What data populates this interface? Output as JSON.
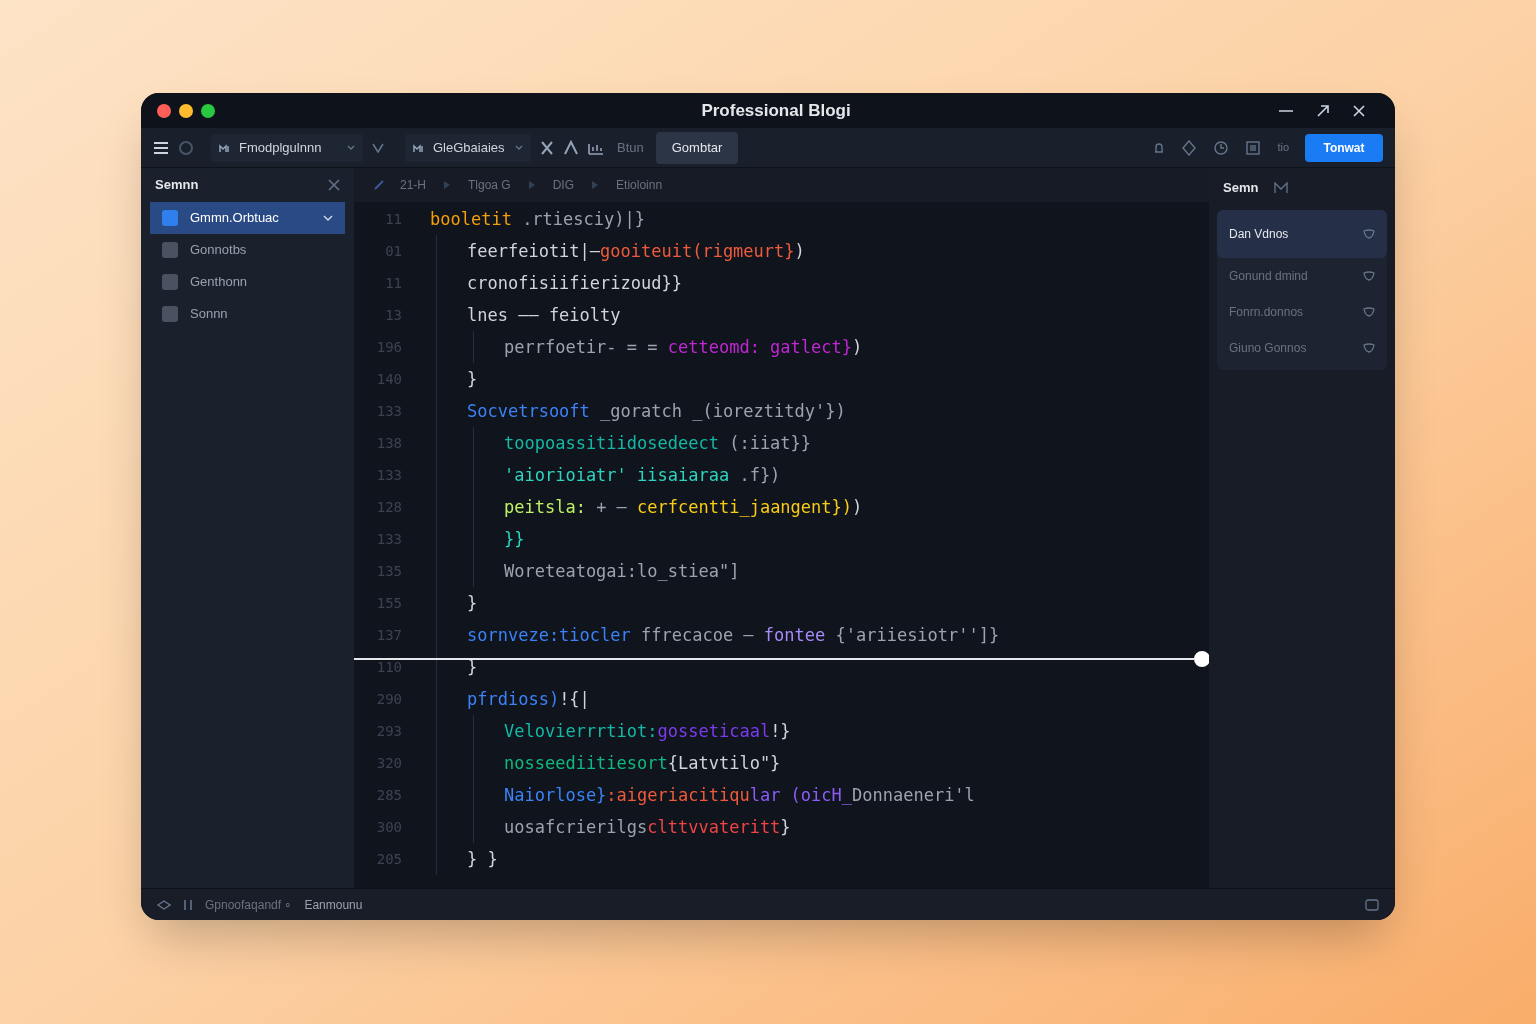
{
  "window": {
    "title": "Professional Blogi"
  },
  "toolbar": {
    "dropdowns": [
      {
        "label": "Fmodplgulnnn"
      },
      {
        "label": "GleGbaiaies"
      }
    ],
    "text_item": "Btun",
    "tab": {
      "label": "Gombtar",
      "selected": true
    },
    "right_text": "tio",
    "primary_button": "Tonwat"
  },
  "sidebar": {
    "title": "Semnn",
    "items": [
      {
        "label": "Gmmn.Orbtuac",
        "selected": true
      },
      {
        "label": "Gonnotbs",
        "selected": false
      },
      {
        "label": "Genthonn",
        "selected": false
      },
      {
        "label": "Sonnn",
        "selected": false
      }
    ]
  },
  "breadcrumbs": [
    "21-H",
    "Tlgoa G",
    "DIG",
    "Etioloinn"
  ],
  "code": {
    "lines": [
      {
        "number": "11",
        "segments": [
          {
            "text": "booletit",
            "color": "#f59e0b"
          },
          {
            "text": " .rtiesciy)|}",
            "color": "#9ca3af"
          }
        ],
        "children": [
          {
            "number": "01",
            "segments": [
              {
                "text": "feerfeiotit|—",
                "color": "#d1d5db"
              },
              {
                "text": "gooiteuit(rigmeurt}",
                "color": "#ef5a3c"
              },
              {
                "text": ")",
                "color": "#d1d5db"
              }
            ]
          },
          {
            "number": "11",
            "segments": [
              {
                "text": "cronofisiifierizoud}}",
                "color": "#d1d5db"
              }
            ]
          },
          {
            "number": "13",
            "segments": [
              {
                "text": "lnes —— feiolty",
                "color": "#d1d5db"
              }
            ],
            "children": [
              {
                "number": "196",
                "segments": [
                  {
                    "text": "perrfoetir- = = ",
                    "color": "#9ca3af"
                  },
                  {
                    "text": "cetteomd: gatlect}",
                    "color": "#c026d3"
                  },
                  {
                    "text": ")",
                    "color": "#d1d5db"
                  }
                ]
              }
            ]
          },
          {
            "number": "140",
            "segments": [
              {
                "text": "}",
                "color": "#d1d5db"
              }
            ]
          },
          {
            "number": "133",
            "segments": [
              {
                "text": "Socvetrsooft ",
                "color": "#3b82f6"
              },
              {
                "text": "_goratch _(ioreztitdy'})",
                "color": "#9ca3af"
              }
            ],
            "children": [
              {
                "number": "138",
                "segments": [
                  {
                    "text": "toopoassitiidosedeect",
                    "color": "#14b8a6"
                  },
                  {
                    "text": " (:iiat}}",
                    "color": "#9ca3af"
                  }
                ]
              },
              {
                "number": "133",
                "segments": [
                  {
                    "text": "'aiorioiatr' iisaiaraa",
                    "color": "#2dd4bf"
                  },
                  {
                    "text": " .f})",
                    "color": "#9ca3af"
                  }
                ]
              },
              {
                "number": "128",
                "segments": [
                  {
                    "text": "peitsla: ",
                    "color": "#bef264"
                  },
                  {
                    "text": "+ — ",
                    "color": "#9ca3af"
                  },
                  {
                    "text": "cerfcentti_jaangent})",
                    "color": "#facc15"
                  },
                  {
                    "text": ")",
                    "color": "#d1d5db"
                  }
                ]
              },
              {
                "number": "133",
                "segments": [
                  {
                    "text": "}}",
                    "color": "#2dd4bf"
                  }
                ]
              },
              {
                "number": "135",
                "segments": [
                  {
                    "text": "Woreteatogai:lo_stiea\"]",
                    "color": "#9ca3af"
                  }
                ]
              }
            ]
          },
          {
            "number": "155",
            "segments": [
              {
                "text": "}",
                "color": "#d1d5db"
              }
            ]
          },
          {
            "number": "137",
            "segments": [
              {
                "text": "sornveze:tiocler ",
                "color": "#3b82f6"
              },
              {
                "text": "ffrecacoe — ",
                "color": "#9ca3af"
              },
              {
                "text": "fontee",
                "color": "#a78bfa"
              },
              {
                "text": " {'ariiesiotr'']}",
                "color": "#9ca3af"
              }
            ]
          },
          {
            "number": "110",
            "segments": [
              {
                "text": "}",
                "color": "#d1d5db"
              }
            ]
          },
          {
            "number": "290",
            "segments": [
              {
                "text": "pfrdioss)",
                "color": "#3b82f6"
              },
              {
                "text": "!{|",
                "color": "#d1d5db"
              }
            ],
            "children": [
              {
                "number": "293",
                "segments": [
                  {
                    "text": "Velovierrrtiot:",
                    "color": "#14b8a6"
                  },
                  {
                    "text": "gosseticaal",
                    "color": "#7c3aed"
                  },
                  {
                    "text": "!}",
                    "color": "#d1d5db"
                  }
                ]
              },
              {
                "number": "320",
                "segments": [
                  {
                    "text": "nosseediitiesort",
                    "color": "#10b981"
                  },
                  {
                    "text": "{Latvtilo\"}",
                    "color": "#d1d5db"
                  }
                ]
              },
              {
                "number": "285",
                "segments": [
                  {
                    "text": "Naiorlose}",
                    "color": "#3b82f6"
                  },
                  {
                    "text": ":aigeriacitiqu",
                    "color": "#ef5a3c"
                  },
                  {
                    "text": "lar (oicH_",
                    "color": "#8b5cf6"
                  },
                  {
                    "text": "Donnaeneri'l",
                    "color": "#9ca3af"
                  }
                ]
              },
              {
                "number": "300",
                "segments": [
                  {
                    "text": "uosafcrierilgs",
                    "color": "#9ca3af"
                  },
                  {
                    "text": "clttvvateritt",
                    "color": "#ef4444"
                  },
                  {
                    "text": "}",
                    "color": "#d1d5db"
                  }
                ]
              }
            ]
          },
          {
            "number": "205",
            "segments": [
              {
                "text": "} }",
                "color": "#d1d5db"
              }
            ]
          }
        ]
      }
    ]
  },
  "right_panel": {
    "title": "Semn",
    "items": [
      {
        "label": "Dan Vdnos",
        "selected": true
      },
      {
        "label": "Gonund dmind",
        "selected": false
      },
      {
        "label": "Fonrn.donnos",
        "selected": false
      },
      {
        "label": "Giuno Gonnos",
        "selected": false
      }
    ]
  },
  "status_bar": {
    "items": [
      "Gpnoofaqandf ∘",
      "Eanmounu"
    ]
  }
}
